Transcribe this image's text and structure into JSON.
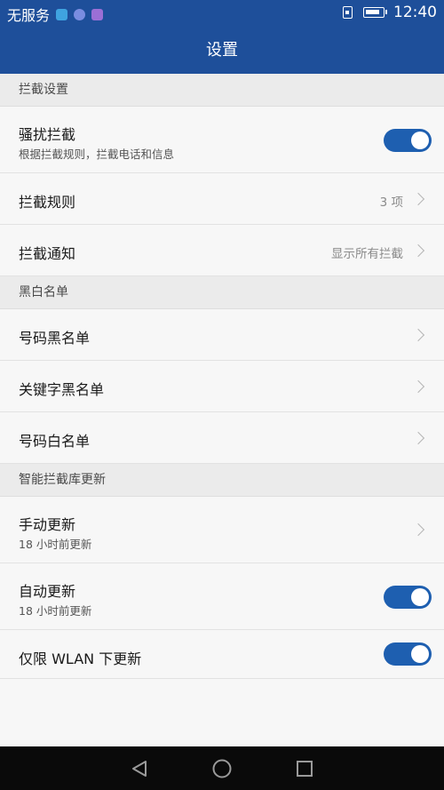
{
  "status_bar": {
    "carrier": "无服务",
    "time": "12:40",
    "badge_colors": [
      "#3fa3e0",
      "#7a8de0",
      "#9b6fd6"
    ]
  },
  "header": {
    "title": "设置"
  },
  "sections": {
    "intercept": {
      "title": "拦截设置",
      "harass": {
        "title": "骚扰拦截",
        "subtitle": "根据拦截规则，拦截电话和信息",
        "enabled": true
      },
      "rules": {
        "title": "拦截规则",
        "value": "3 项"
      },
      "notify": {
        "title": "拦截通知",
        "value": "显示所有拦截"
      }
    },
    "lists": {
      "title": "黑白名单",
      "number_blacklist": {
        "title": "号码黑名单"
      },
      "keyword_blacklist": {
        "title": "关键字黑名单"
      },
      "number_whitelist": {
        "title": "号码白名单"
      }
    },
    "update": {
      "title": "智能拦截库更新",
      "manual": {
        "title": "手动更新",
        "subtitle": "18 小时前更新"
      },
      "auto": {
        "title": "自动更新",
        "subtitle": "18 小时前更新",
        "enabled": true
      },
      "wlan_only": {
        "title": "仅限 WLAN 下更新",
        "enabled": true
      }
    }
  },
  "nav": {
    "back_icon": "triangle-back-icon",
    "home_icon": "circle-home-icon",
    "recent_icon": "square-recent-icon"
  },
  "colors": {
    "accent": "#1e4f9a",
    "toggle_on": "#1e5fb0"
  }
}
